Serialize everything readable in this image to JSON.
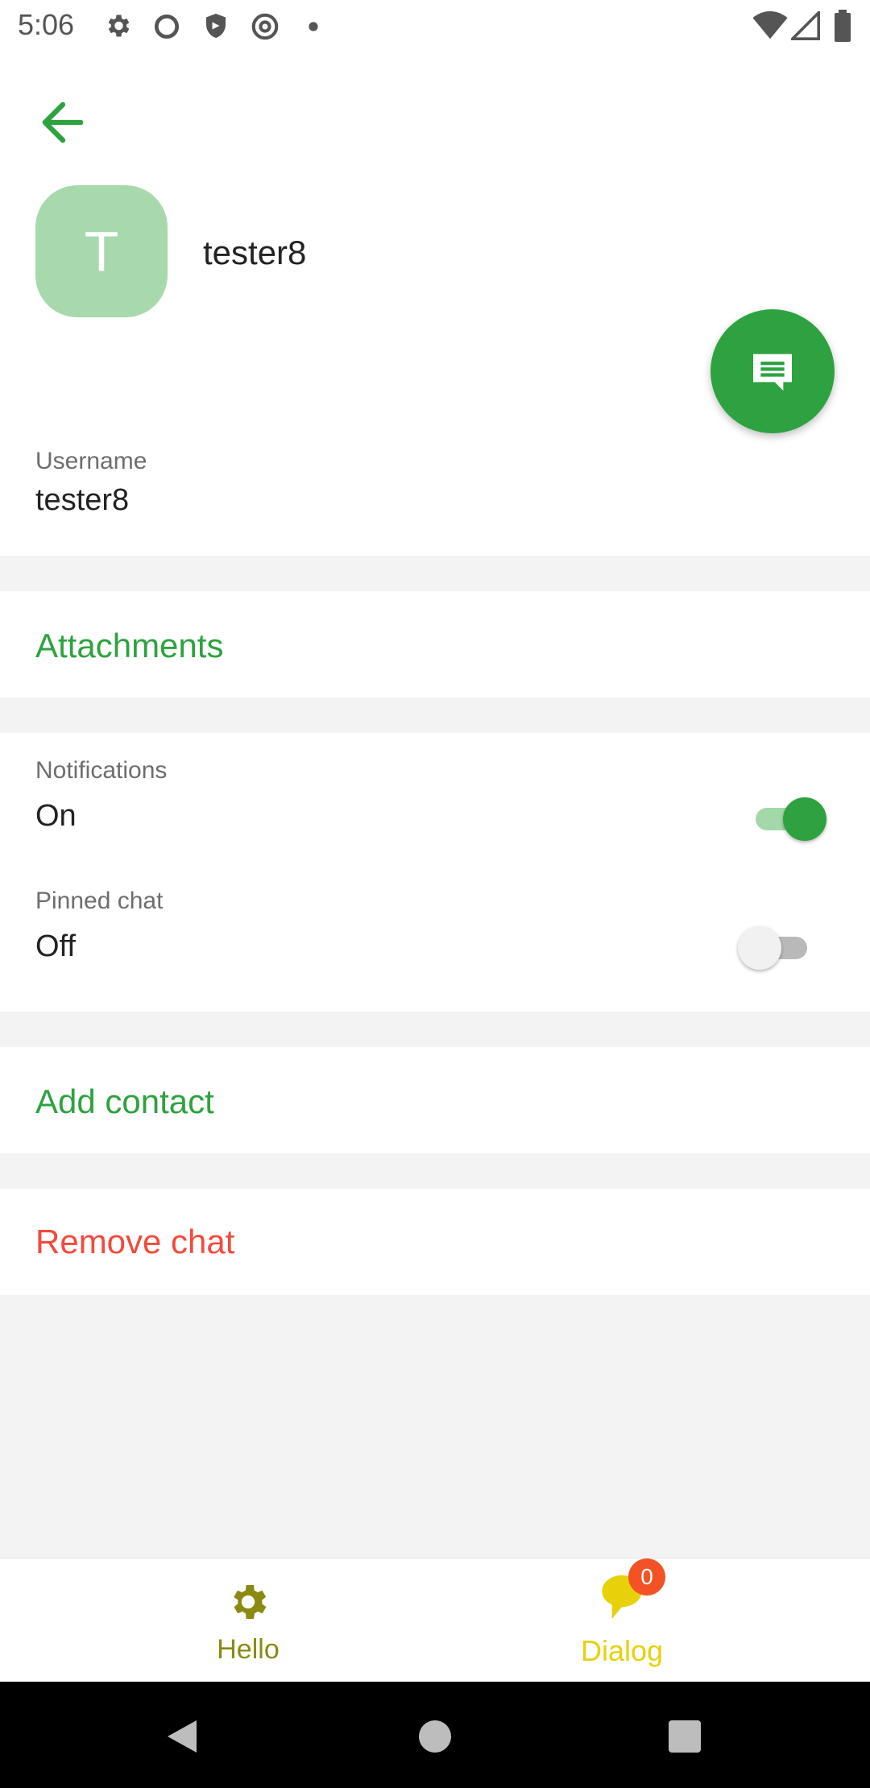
{
  "status_bar": {
    "time": "5:06",
    "icons": [
      "gear-icon",
      "circle-icon",
      "shield-icon",
      "at-icon",
      "dot-icon",
      "wifi-icon",
      "signal-icon",
      "battery-icon"
    ]
  },
  "header": {
    "back_icon": "arrow-left-icon",
    "avatar_letter": "T",
    "name": "tester8"
  },
  "fab": {
    "icon": "message-icon"
  },
  "profile": {
    "username_label": "Username",
    "username_value": "tester8"
  },
  "attachments": {
    "label": "Attachments"
  },
  "settings": {
    "notifications_label": "Notifications",
    "notifications_value": "On",
    "notifications_enabled": true,
    "pinned_label": "Pinned chat",
    "pinned_value": "Off",
    "pinned_enabled": false
  },
  "actions": {
    "add_contact": "Add contact",
    "remove_chat": "Remove chat"
  },
  "bottom_nav": {
    "items": [
      {
        "label": "Hello",
        "icon": "gear-icon"
      },
      {
        "label": "Dialog",
        "icon": "chat-bubble-icon",
        "badge": "0"
      }
    ]
  },
  "colors": {
    "accent": "#2ea240",
    "danger": "#f4493c",
    "avatar_bg": "#a8d9ad",
    "nav_hello": "#8a8a12",
    "nav_dialog": "#e8d10a",
    "badge": "#f25225"
  }
}
